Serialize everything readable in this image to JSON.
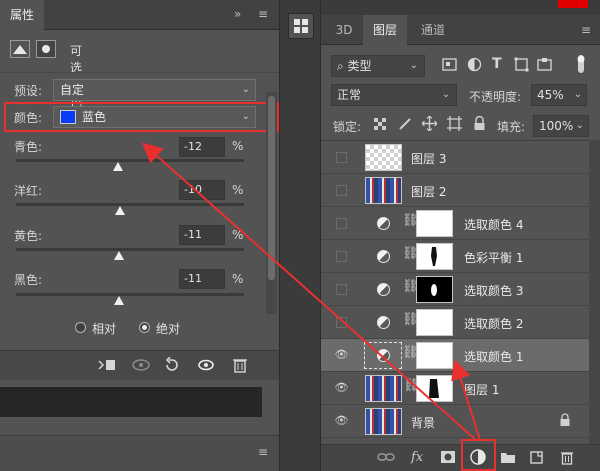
{
  "properties_panel": {
    "tab_label": "属性",
    "collapse_glyph": "»",
    "menu_glyph": "≡",
    "adjustment_title": "可选颜色",
    "preset_label": "预设:",
    "preset_value": "自定",
    "color_label": "颜色:",
    "color_value": "蓝色",
    "color_swatch_hex": "#0a3df5",
    "sliders": [
      {
        "label": "青色:",
        "value": "-12",
        "unit": "%"
      },
      {
        "label": "洋红:",
        "value": "-10",
        "unit": "%"
      },
      {
        "label": "黄色:",
        "value": "-11",
        "unit": "%"
      },
      {
        "label": "黑色:",
        "value": "-11",
        "unit": "%"
      }
    ],
    "method_relative": "相对",
    "method_absolute": "绝对",
    "method_selected": "绝对",
    "footer_icons": [
      "clip-to-layer-icon",
      "view-previous-icon",
      "reset-icon",
      "visibility-icon",
      "trash-icon"
    ]
  },
  "middle_dock": {
    "icons": [
      "layer-comps-icon"
    ]
  },
  "layers_panel": {
    "tabs": [
      "3D",
      "图层",
      "通道"
    ],
    "active_tab": "图层",
    "filter_kind": "类型",
    "blend_mode": "正常",
    "opacity_label": "不透明度:",
    "opacity_value": "45%",
    "lock_label": "锁定:",
    "fill_label": "填充:",
    "fill_value": "100%",
    "layers": [
      {
        "name": "图层 3",
        "visible": false,
        "kind": "pixel-transparent",
        "selected": false
      },
      {
        "name": "图层 2",
        "visible": false,
        "kind": "pixel-image",
        "selected": false
      },
      {
        "name": "选取颜色 4",
        "visible": false,
        "kind": "adjustment",
        "selected": false
      },
      {
        "name": "色彩平衡 1",
        "visible": false,
        "kind": "adjustment",
        "selected": false
      },
      {
        "name": "选取颜色 3",
        "visible": false,
        "kind": "adjustment",
        "selected": false
      },
      {
        "name": "选取颜色 2",
        "visible": false,
        "kind": "adjustment",
        "selected": false
      },
      {
        "name": "选取颜色 1",
        "visible": true,
        "kind": "adjustment",
        "selected": true
      },
      {
        "name": "图层 1",
        "visible": true,
        "kind": "pixel-masked",
        "selected": false
      },
      {
        "name": "背景",
        "visible": true,
        "kind": "background-locked",
        "selected": false
      }
    ],
    "footer_icons": [
      "link-layers-icon",
      "fx-icon",
      "add-mask-icon",
      "adjustment-layer-icon",
      "group-folder-icon",
      "new-layer-icon",
      "trash-icon"
    ]
  },
  "annotation_color": "#ea2f2f"
}
